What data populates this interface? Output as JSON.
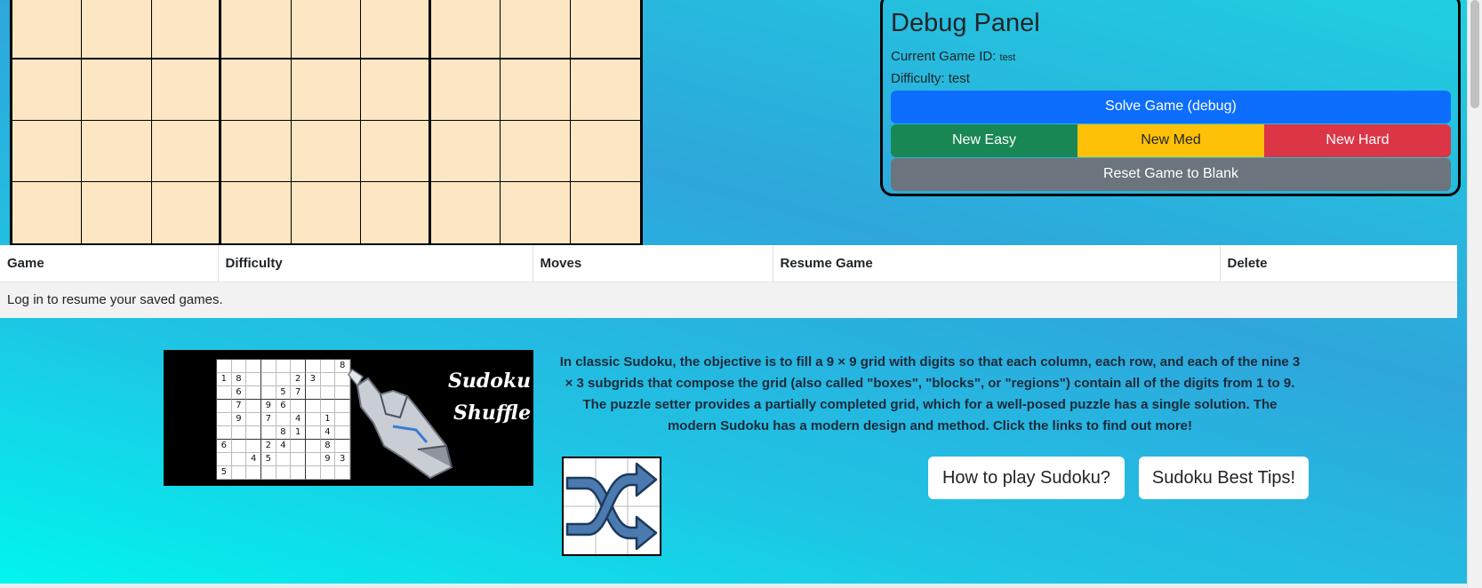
{
  "debug_panel": {
    "title": "Debug Panel",
    "game_id_label": "Current Game ID:",
    "game_id_value": "test",
    "difficulty_label": "Difficulty: test",
    "solve_label": "Solve Game (debug)",
    "new_easy_label": "New Easy",
    "new_med_label": "New Med",
    "new_hard_label": "New Hard",
    "reset_label": "Reset Game to Blank"
  },
  "saved_games": {
    "columns": [
      "Game",
      "Difficulty",
      "Moves",
      "Resume Game",
      "Delete"
    ],
    "empty_message": "Log in to resume your saved games."
  },
  "banner": {
    "title_line1": "Sudoku",
    "title_line2": "Shuffle",
    "grid_digits": [
      [
        "",
        "",
        "",
        "",
        "",
        "",
        "",
        "",
        "8"
      ],
      [
        "1",
        "8",
        "",
        "",
        "",
        "2",
        "3",
        "",
        ""
      ],
      [
        "",
        "6",
        "",
        "",
        "5",
        "7",
        "",
        "",
        ""
      ],
      [
        "",
        "7",
        "",
        "9",
        "6",
        "",
        "",
        "",
        ""
      ],
      [
        "",
        "9",
        "",
        "7",
        "",
        "4",
        "",
        "1",
        ""
      ],
      [
        "",
        "",
        "",
        "",
        "8",
        "1",
        "",
        "4",
        ""
      ],
      [
        "6",
        "",
        "",
        "2",
        "4",
        "",
        "",
        "8",
        ""
      ],
      [
        "",
        "",
        "4",
        "5",
        "",
        "",
        "",
        "9",
        "3"
      ],
      [
        "5",
        "",
        "",
        "",
        "",
        "",
        "",
        "",
        ""
      ]
    ]
  },
  "description": "In classic Sudoku, the objective is to fill a 9 × 9 grid with digits so that each column, each row, and each of the nine 3 × 3 subgrids that compose the grid (also called \"boxes\", \"blocks\", or \"regions\") contain all of the digits from 1 to 9. The puzzle setter provides a partially completed grid, which for a well-posed puzzle has a single solution. The modern Sudoku has a modern design and method. Click the links to find out more!",
  "links": {
    "how_to_play": "How to play Sudoku?",
    "best_tips": "Sudoku Best Tips!"
  },
  "icons": {
    "shuffle": "shuffle-icon",
    "robot_hand": "robot-hand-icon"
  },
  "colors": {
    "cell_background": "#fce6c3",
    "solve": "#0d6efd",
    "easy": "#198754",
    "med": "#ffc107",
    "hard": "#dc3545",
    "reset": "#6c757d",
    "shuffle_arrow": "#4a7ab0"
  }
}
